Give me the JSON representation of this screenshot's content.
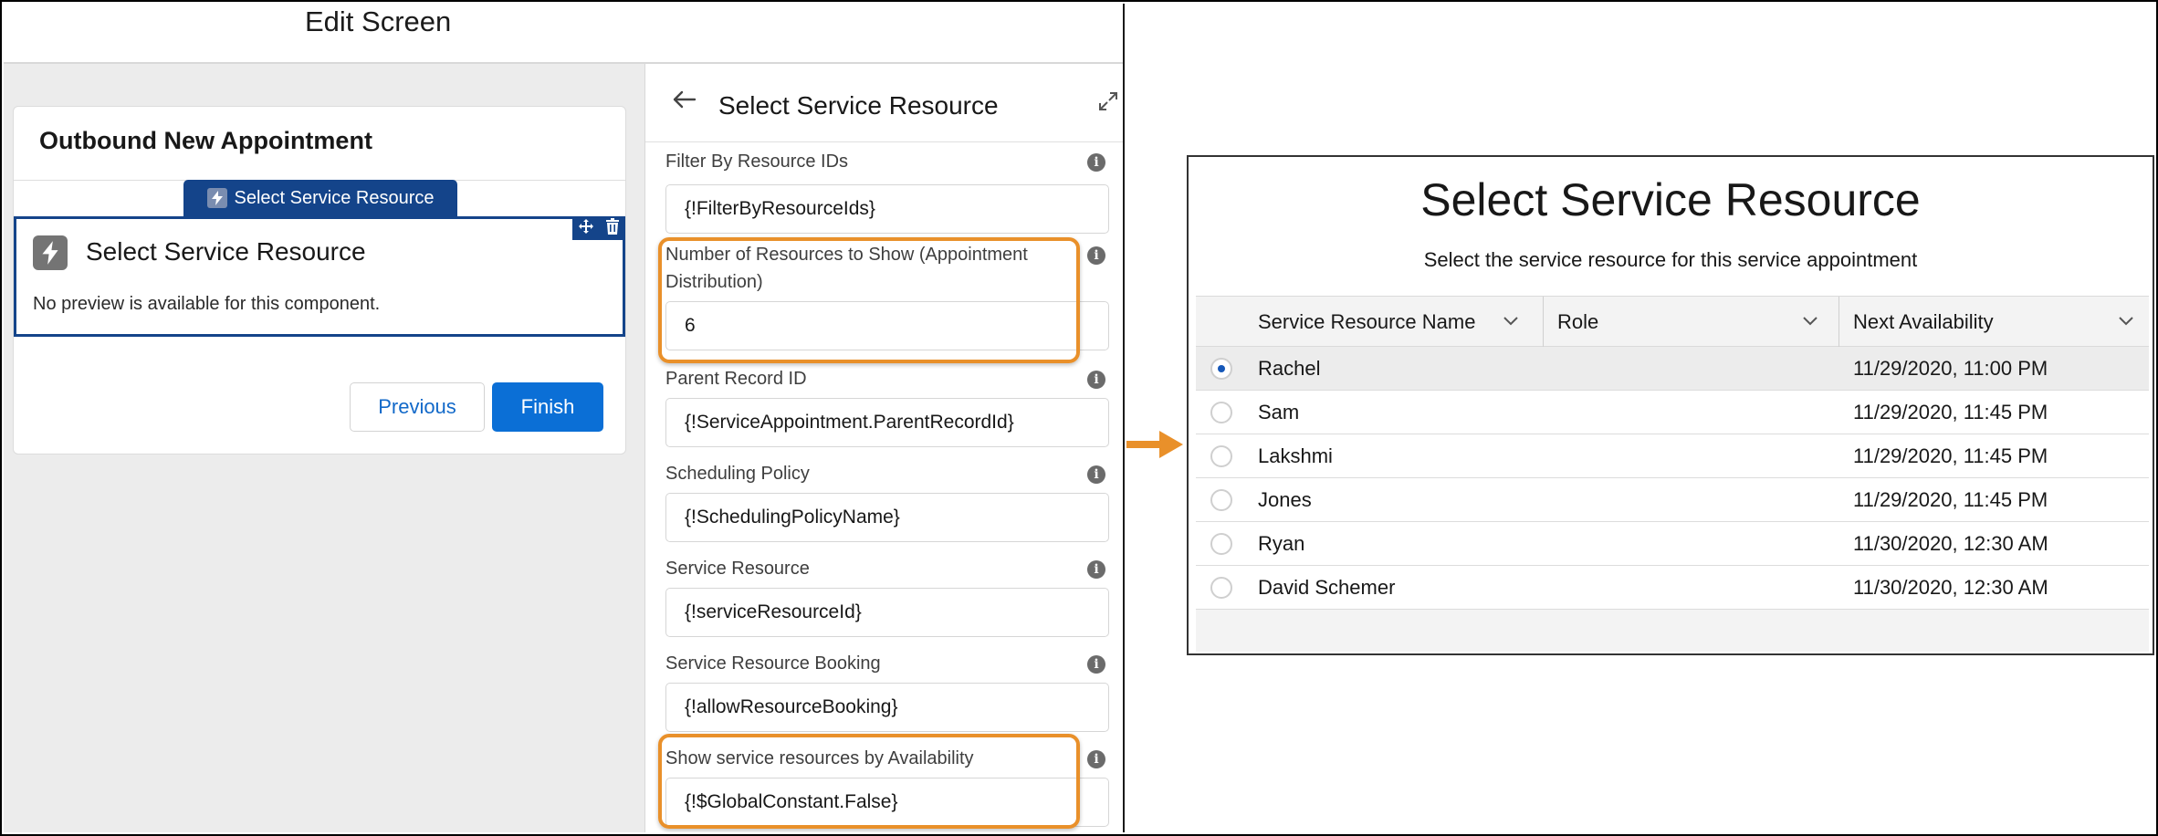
{
  "editor": {
    "title": "Edit Screen",
    "screen_name": "Outbound New Appointment",
    "component_tab_label": "Select Service Resource",
    "component_title": "Select Service Resource",
    "component_note": "No preview is available for this component.",
    "previous_label": "Previous",
    "finish_label": "Finish"
  },
  "properties": {
    "title": "Select Service Resource",
    "fields": [
      {
        "label": "Filter By Resource IDs",
        "value": "{!FilterByResourceIds}"
      },
      {
        "label": "Number of Resources to Show (Appointment Distribution)",
        "value": "6",
        "highlighted": true
      },
      {
        "label": "Parent Record ID",
        "value": "{!ServiceAppointment.ParentRecordId}"
      },
      {
        "label": "Scheduling Policy",
        "value": "{!SchedulingPolicyName}"
      },
      {
        "label": "Service Resource",
        "value": "{!serviceResourceId}"
      },
      {
        "label": "Service Resource Booking",
        "value": "{!allowResourceBooking}"
      },
      {
        "label": "Show service resources by Availability",
        "value": "{!$GlobalConstant.False}",
        "highlighted": true
      }
    ]
  },
  "preview": {
    "title": "Select Service Resource",
    "subtitle": "Select the service resource for this service appointment",
    "columns": [
      "Service Resource Name",
      "Role",
      "Next Availability"
    ],
    "rows": [
      {
        "name": "Rachel",
        "role": "",
        "next": "11/29/2020, 11:00 PM",
        "selected": true
      },
      {
        "name": "Sam",
        "role": "",
        "next": "11/29/2020, 11:45 PM",
        "selected": false
      },
      {
        "name": "Lakshmi",
        "role": "",
        "next": "11/29/2020, 11:45 PM",
        "selected": false
      },
      {
        "name": "Jones",
        "role": "",
        "next": "11/29/2020, 11:45 PM",
        "selected": false
      },
      {
        "name": "Ryan",
        "role": "",
        "next": "11/30/2020, 12:30 AM",
        "selected": false
      },
      {
        "name": "David Schemer",
        "role": "",
        "next": "11/30/2020, 12:30 AM",
        "selected": false
      }
    ]
  },
  "colors": {
    "brand_blue": "#0b6fd6",
    "selected_blue": "#14448a",
    "highlight_orange": "#e9902a"
  },
  "icons": [
    "bolt-icon",
    "move-icon",
    "trash-icon",
    "back-arrow-icon",
    "expand-icon",
    "info-icon",
    "chevron-down-icon",
    "arrow-right-icon"
  ]
}
